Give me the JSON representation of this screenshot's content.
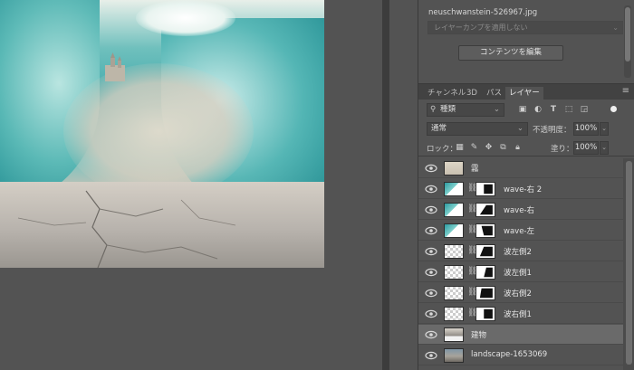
{
  "properties": {
    "filename": "neuschwanstein-526967.jpg",
    "layer_comp_placeholder": "レイヤーカンプを適用しない",
    "edit_contents_label": "コンテンツを編集"
  },
  "layers_panel": {
    "tabs": [
      {
        "label": "チャンネル",
        "active": false
      },
      {
        "label": "3D",
        "active": false
      },
      {
        "label": "パス",
        "active": false
      },
      {
        "label": "レイヤー",
        "active": true
      }
    ],
    "filter_kind": "種類",
    "blend_mode": "通常",
    "opacity_label": "不透明度：",
    "opacity_value": "100%",
    "lock_label": "ロック：",
    "fill_label": "塗り：",
    "fill_value": "100%",
    "layers": [
      {
        "name": "霧",
        "has_mask": false,
        "thumb": "fog",
        "selected": false
      },
      {
        "name": "wave-右 2",
        "has_mask": true,
        "thumb": "wave",
        "selected": false
      },
      {
        "name": "wave-右",
        "has_mask": true,
        "thumb": "wave",
        "selected": false
      },
      {
        "name": "wave-左",
        "has_mask": true,
        "thumb": "wave",
        "selected": false
      },
      {
        "name": "波左側2",
        "has_mask": true,
        "thumb": "checker",
        "selected": false
      },
      {
        "name": "波左側1",
        "has_mask": true,
        "thumb": "checker",
        "selected": false
      },
      {
        "name": "波右側2",
        "has_mask": true,
        "thumb": "checker",
        "selected": false
      },
      {
        "name": "波右側1",
        "has_mask": true,
        "thumb": "checker",
        "selected": false
      },
      {
        "name": "建物",
        "has_mask": false,
        "thumb": "building",
        "selected": true
      },
      {
        "name": "landscape-1653069",
        "has_mask": false,
        "thumb": "landscape",
        "selected": false
      }
    ]
  },
  "colors": {
    "panel_bg": "#535353",
    "selected_row": "#6a6a6a",
    "tab_bar": "#424242"
  }
}
